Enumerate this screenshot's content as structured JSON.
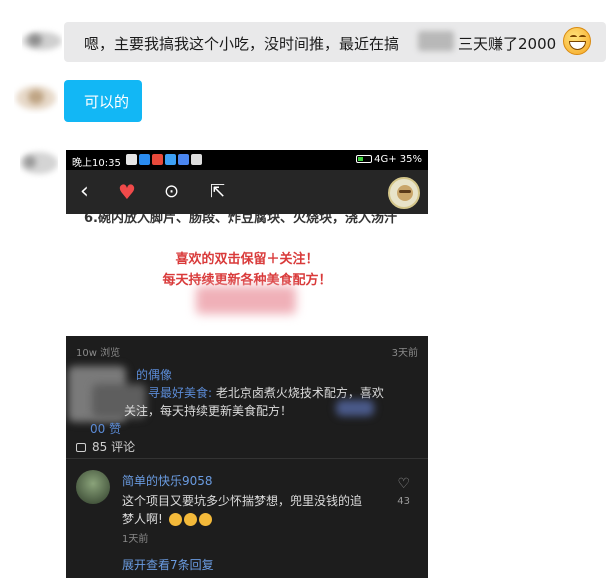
{
  "chat": {
    "message1_text": "嗯，主要我搞我这个小吃，没时间推，最近在搞",
    "message1_text_end": "三天赚了2000",
    "message1_emoji": "grinning-face-emoji",
    "message2_text": "可以的"
  },
  "screenshot": {
    "status_time": "晚上10:35",
    "status_right": "4G+  35%",
    "cut_text": "6.碗内放入脚片、肠段、炸豆腐块、火烧块，浇入汤汁",
    "promo_line1": "喜欢的双击保留＋关注！",
    "promo_line2": "每天持续更新各种美食配方！",
    "views": "10w 浏览",
    "posted_ago": "3天前",
    "author_name_partial": "的偶像",
    "author_highlight": "寻最好美食:",
    "author_line1_rest": " 老北京卤煮火烧技术配方，喜欢",
    "author_line2": "关注，每天持续更新美食配方！",
    "likes_partial": "00 赞",
    "comments_count": "85 评论",
    "comment_user": "简单的快乐9058",
    "comment_line1": "这个项目又要坑多少怀揣梦想，兜里没钱的追",
    "comment_line2": "梦人啊!",
    "comment_time": "1天前",
    "comment_like_count": "43",
    "expand_replies": "展开查看7条回复"
  },
  "colors": {
    "chat_bubble_grey": "#e9e9ea",
    "chat_bubble_blue": "#12b7f5",
    "promo_red": "#d93a3a",
    "link_blue": "#6a9be0",
    "phone_bg": "#1d1d1d"
  }
}
